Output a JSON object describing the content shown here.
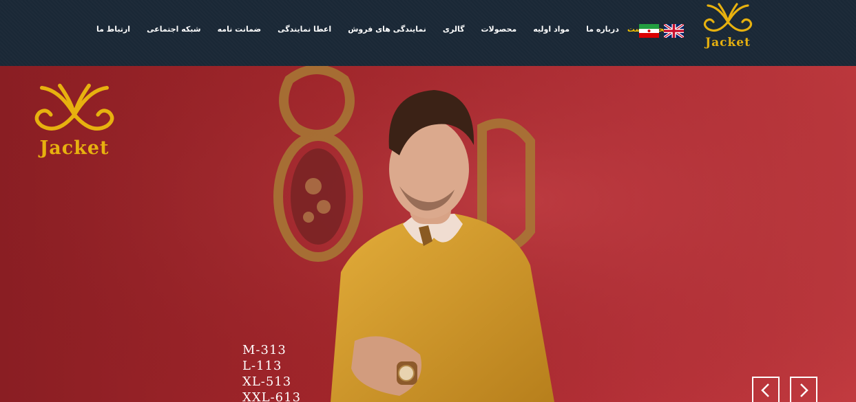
{
  "brand": {
    "name": "Jacket",
    "color": "#e7b10f"
  },
  "nav": {
    "items": [
      {
        "label": "صفحه نخست",
        "active": true
      },
      {
        "label": "درباره ما",
        "active": false
      },
      {
        "label": "مواد اولیه",
        "active": false
      },
      {
        "label": "محصولات",
        "active": false
      },
      {
        "label": "گالری",
        "active": false
      },
      {
        "label": "نمایندگی های فروش",
        "active": false
      },
      {
        "label": "اعطا نمایندگی",
        "active": false
      },
      {
        "label": "ضمانت نامه",
        "active": false
      },
      {
        "label": "شبکه اجتماعی",
        "active": false
      },
      {
        "label": "ارتباط ما",
        "active": false
      }
    ],
    "active_color": "#f2c200"
  },
  "languages": [
    {
      "name": "english",
      "icon": "uk-flag-icon"
    },
    {
      "name": "persian",
      "icon": "iran-flag-icon"
    }
  ],
  "hero": {
    "sizes": [
      "M-313",
      "L-113",
      "XL-513",
      "XXL-613"
    ],
    "controls": {
      "prev_icon": "chevron-left-icon",
      "next_icon": "chevron-right-icon"
    }
  }
}
